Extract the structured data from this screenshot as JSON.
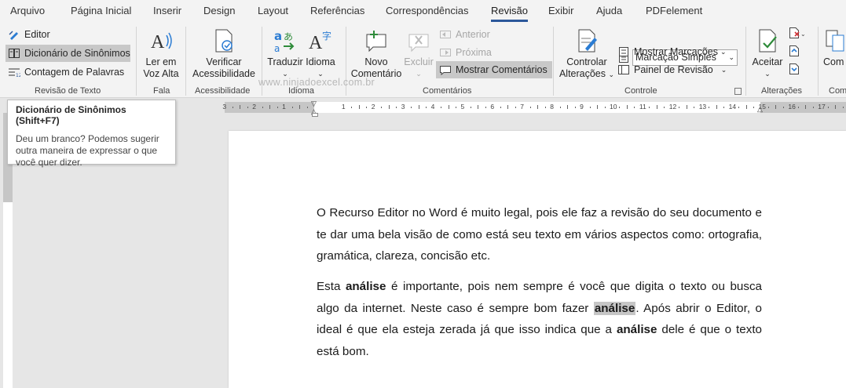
{
  "tabs": [
    "Arquivo",
    "Página Inicial",
    "Inserir",
    "Design",
    "Layout",
    "Referências",
    "Correspondências",
    "Revisão",
    "Exibir",
    "Ajuda",
    "PDFelement"
  ],
  "active_tab": "Revisão",
  "ribbon": {
    "revisao_texto": {
      "editor": "Editor",
      "dicionario": "Dicionário de Sinônimos",
      "contagem": "Contagem de Palavras",
      "label": "Revisão de Texto"
    },
    "fala": {
      "ler_line1": "Ler em",
      "ler_line2": "Voz Alta",
      "label": "Fala"
    },
    "acessibilidade": {
      "verificar_line1": "Verificar",
      "verificar_line2": "Acessibilidade",
      "label": "Acessibilidade"
    },
    "idioma": {
      "traduzir": "Traduzir",
      "idioma": "Idioma",
      "label": "Idioma"
    },
    "comentarios": {
      "novo_line1": "Novo",
      "novo_line2": "Comentário",
      "excluir": "Excluir",
      "anterior": "Anterior",
      "proxima": "Próxima",
      "mostrar": "Mostrar Comentários",
      "label": "Comentários"
    },
    "controle": {
      "controlar_line1": "Controlar",
      "controlar_line2": "Alterações",
      "marcacao_select": "Marcação Simples",
      "mostrar_marcacoes": "Mostrar Marcações",
      "painel": "Painel de Revisão",
      "label": "Controle"
    },
    "alteracoes": {
      "aceitar": "Aceitar",
      "label": "Alterações"
    },
    "comparar": {
      "label_partial": "Com",
      "btn_partial": "Com"
    }
  },
  "watermark": "www.ninjadoexcel.com.br",
  "ruler": {
    "ticks": [
      "3",
      "2",
      "1",
      "1",
      "2",
      "3",
      "4",
      "5",
      "6",
      "7",
      "8",
      "9",
      "10",
      "11",
      "12",
      "13",
      "14",
      "15",
      "16",
      "17"
    ]
  },
  "tooltip": {
    "title": "Dicionário de Sinônimos (Shift+F7)",
    "body": "Deu um branco? Podemos sugerir outra maneira de expressar o que você quer dizer."
  },
  "document": {
    "p1": "O Recurso Editor no Word é muito legal, pois ele faz a revisão do seu documento e te dar uma bela visão de como está seu texto em vários aspectos como: ortografia, gramática, clareza, concisão etc.",
    "p2_a": "Esta ",
    "p2_b": "análise",
    "p2_c": " é importante, pois nem sempre é você que digita o texto ou busca algo da internet. Neste caso é sempre bom fazer ",
    "p2_d": "análise",
    "p2_e": ". Após abrir o Editor, o ideal é que ela esteja zerada já que isso indica que a ",
    "p2_f": "análise",
    "p2_g": " dele é que o texto está bom."
  },
  "colors": {
    "accent": "#2b579a",
    "ribbon_bg": "#f3f3f3",
    "selection": "#c6c6c6",
    "translate_blue": "#2b7cd3",
    "translate_green": "#2e8b3a",
    "delete_red": "#d13438"
  }
}
